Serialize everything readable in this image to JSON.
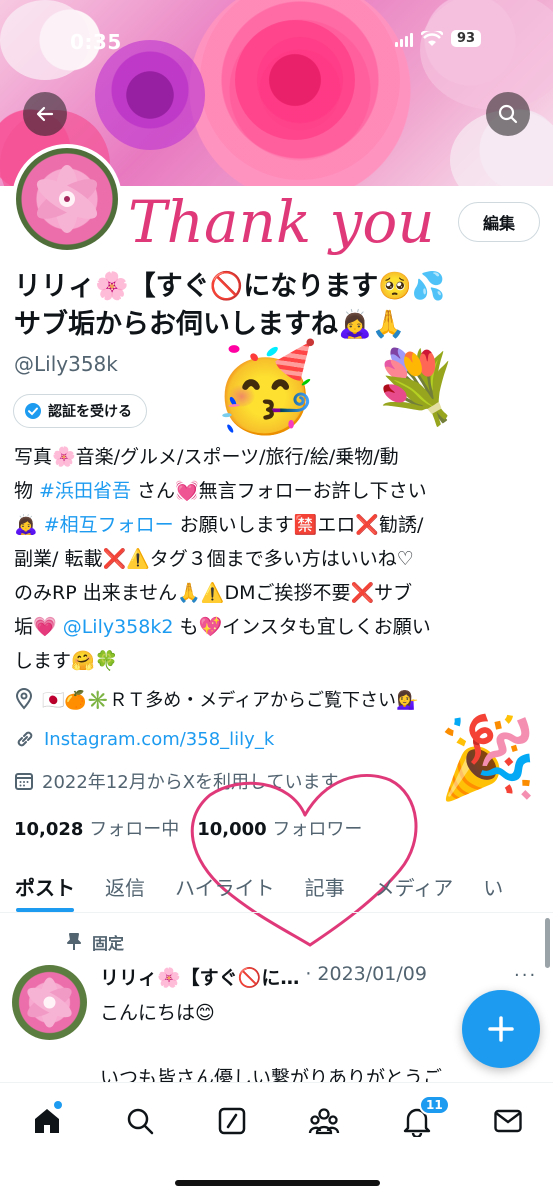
{
  "status_bar": {
    "time": "0:35",
    "battery": "93"
  },
  "banner": {
    "overlay_text": "Thank you"
  },
  "profile": {
    "display_name_line1": "リリィ🌸【すぐ🚫になります🥺💦",
    "display_name_line2": "サブ垢からお伺いしますね🙇‍♀️🙏",
    "handle": "@Lily358k",
    "edit_label": "編集",
    "verify_label": "認証を受ける",
    "bio_lines": [
      [
        "写真🌸音楽/グルメ/スポーツ/旅行/絵/乗物/動"
      ],
      [
        "物 ",
        "#浜田省吾",
        " さん💓無言フォローお許し下さい"
      ],
      [
        "🙇‍♀️ ",
        "#相互フォロー",
        " お願いします🈲エロ❌勧誘/"
      ],
      [
        "副業/ 転載❌⚠️タグ３個まで多い方はいいね♡"
      ],
      [
        "のみRP 出来ません🙏⚠️DMご挨拶不要❌サブ"
      ],
      [
        "垢💗 ",
        "@Lily358k2",
        " も💖インスタも宜しくお願い"
      ],
      [
        "します🤗🍀"
      ]
    ],
    "location": "🇯🇵🍊✳️ＲＴ多め・メディアからご覧下さい💁‍♀️",
    "website": "Instagram.com/358_lily_k",
    "joined": "2022年12月からXを利用しています",
    "following_count": "10,028",
    "following_label": "フォロー中",
    "followers_count": "10,000",
    "followers_label": "フォロワー"
  },
  "tabs": [
    {
      "label": "ポスト"
    },
    {
      "label": "返信"
    },
    {
      "label": "ハイライト"
    },
    {
      "label": "記事"
    },
    {
      "label": "メディア"
    },
    {
      "label": "い"
    }
  ],
  "pinned_post": {
    "pinned_label": "固定",
    "author": "リリィ🌸【すぐ🚫に…",
    "date": "· 2023/01/09",
    "more": "···",
    "line1": "こんにちは😊",
    "line2": "いつも皆さん優しい繋がりありがとうご"
  },
  "bottom_nav": {
    "notification_count": "11"
  },
  "decor": {
    "party_face": "🥳",
    "bouquet": "💐",
    "popper": "🎉"
  },
  "colors": {
    "accent": "#1d9bf0",
    "thank_you": "#e0397a",
    "heart_outline": "#e0397a",
    "text_secondary": "#536471"
  }
}
